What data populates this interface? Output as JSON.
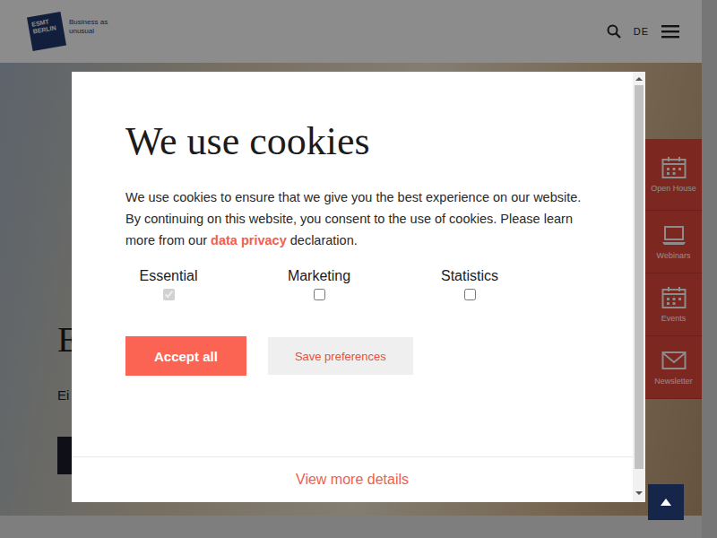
{
  "header": {
    "logo_mark": "ESMT BERLIN",
    "tagline": "Business as unusual",
    "language": "DE"
  },
  "hero": {
    "heading": "E",
    "subtitle": "Ei"
  },
  "sidebar": {
    "items": [
      {
        "label": "Open House"
      },
      {
        "label": "Webinars"
      },
      {
        "label": "Events"
      },
      {
        "label": "Newsletter"
      }
    ]
  },
  "cookie_dialog": {
    "title": "We use cookies",
    "text_before_link": "We use cookies to ensure that we give you the best experience on our website. By continuing on this website, you consent to the use of cookies. Please learn more from our",
    "link": "data privacy",
    "text_after_link": "declaration.",
    "options": [
      {
        "label": "Essential",
        "checked": true,
        "disabled": true
      },
      {
        "label": "Marketing",
        "checked": false,
        "disabled": false
      },
      {
        "label": "Statistics",
        "checked": false,
        "disabled": false
      }
    ],
    "buttons": [
      {
        "label": "Accept all",
        "kind": "primary"
      },
      {
        "label": "Save preferences",
        "kind": "secondary"
      }
    ],
    "details_link": "View more details"
  }
}
